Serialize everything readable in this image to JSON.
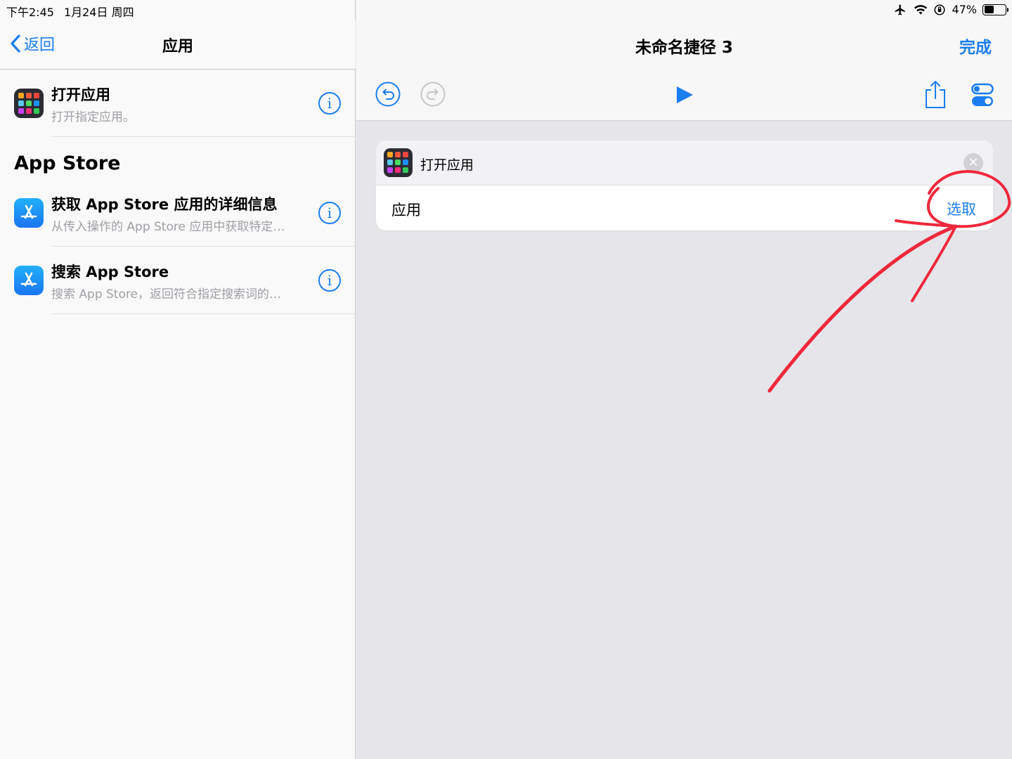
{
  "status_bar": {
    "time": "下午2:45",
    "date": "1月24日 周四",
    "battery": "47%",
    "battery_level": 0.47
  },
  "left_panel": {
    "back_label": "返回",
    "title": "应用",
    "items": [
      {
        "title": "打开应用",
        "subtitle": "打开指定应用。",
        "icon": "app-grid-icon"
      }
    ],
    "section": {
      "header": "App Store",
      "items": [
        {
          "title": "获取 App Store 应用的详细信息",
          "subtitle": "从传入操作的 App Store 应用中获取特定…",
          "icon": "app-store-icon"
        },
        {
          "title": "搜索 App Store",
          "subtitle": "搜索 App Store，返回符合指定搜索词的…",
          "icon": "app-store-icon"
        }
      ]
    },
    "info_glyph": "i"
  },
  "editor": {
    "title": "未命名捷径 3",
    "done_label": "完成",
    "action_card": {
      "title": "打开应用",
      "param_label": "应用",
      "param_value": "选取",
      "close_glyph": "✕"
    }
  },
  "colors": {
    "accent": "#1a7df0",
    "annotation": "#f0283c",
    "grid_tiles": [
      "#f5a623",
      "#f2593a",
      "#e8463c",
      "#5ac8fa",
      "#4cd964",
      "#1e90ff",
      "#c643fc",
      "#ff2d78",
      "#34c759"
    ]
  }
}
